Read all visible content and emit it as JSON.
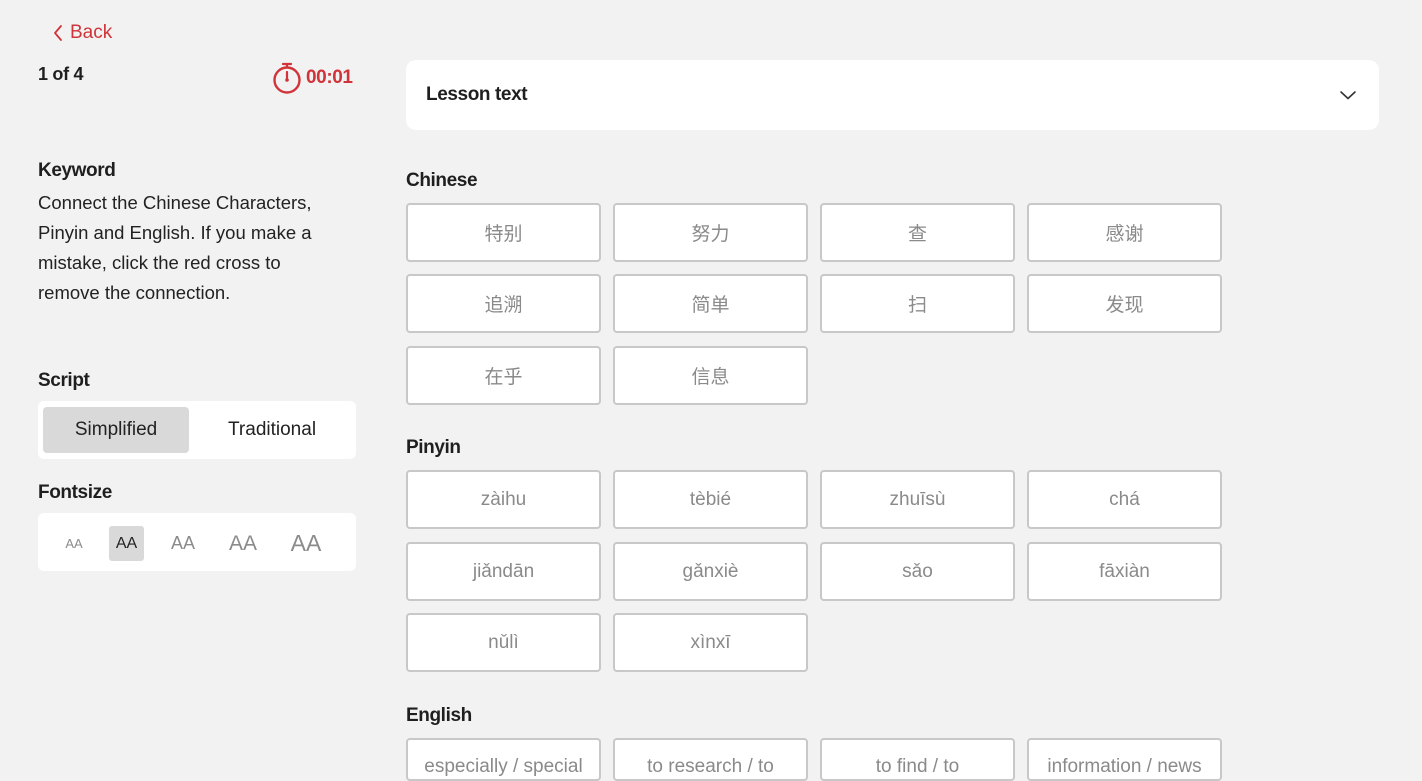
{
  "nav": {
    "back_label": "Back"
  },
  "progress": {
    "text": "1 of 4"
  },
  "timer": {
    "value": "00:01"
  },
  "keyword": {
    "title": "Keyword",
    "instructions": "Connect the Chinese Characters, Pinyin and English. If you make a mistake, click the red cross to remove the connection."
  },
  "script": {
    "title": "Script",
    "options": [
      "Simplified",
      "Traditional"
    ],
    "selected": "Simplified"
  },
  "fontsize": {
    "title": "Fontsize",
    "options": [
      "AA",
      "AA",
      "AA",
      "AA",
      "AA"
    ],
    "selected_index": 1
  },
  "lesson_text": {
    "label": "Lesson text"
  },
  "groups": {
    "chinese": {
      "title": "Chinese",
      "items": [
        "特别",
        "努力",
        "查",
        "感谢",
        "追溯",
        "简单",
        "扫",
        "发现",
        "在乎",
        "信息"
      ]
    },
    "pinyin": {
      "title": "Pinyin",
      "items": [
        "zàihu",
        "tèbié",
        "zhuīsù",
        "chá",
        "jiǎndān",
        "gǎnxiè",
        "sǎo",
        "fāxiàn",
        "nǔlì",
        "xìnxī"
      ]
    },
    "english": {
      "title": "English",
      "items": [
        "especially / special",
        "to research / to",
        "to find / to",
        "information / news"
      ]
    }
  },
  "colors": {
    "accent": "#d0343a",
    "background": "#f2f2f2",
    "tile_border": "#c8c8c8",
    "selected_bg": "#d9d9d9"
  }
}
